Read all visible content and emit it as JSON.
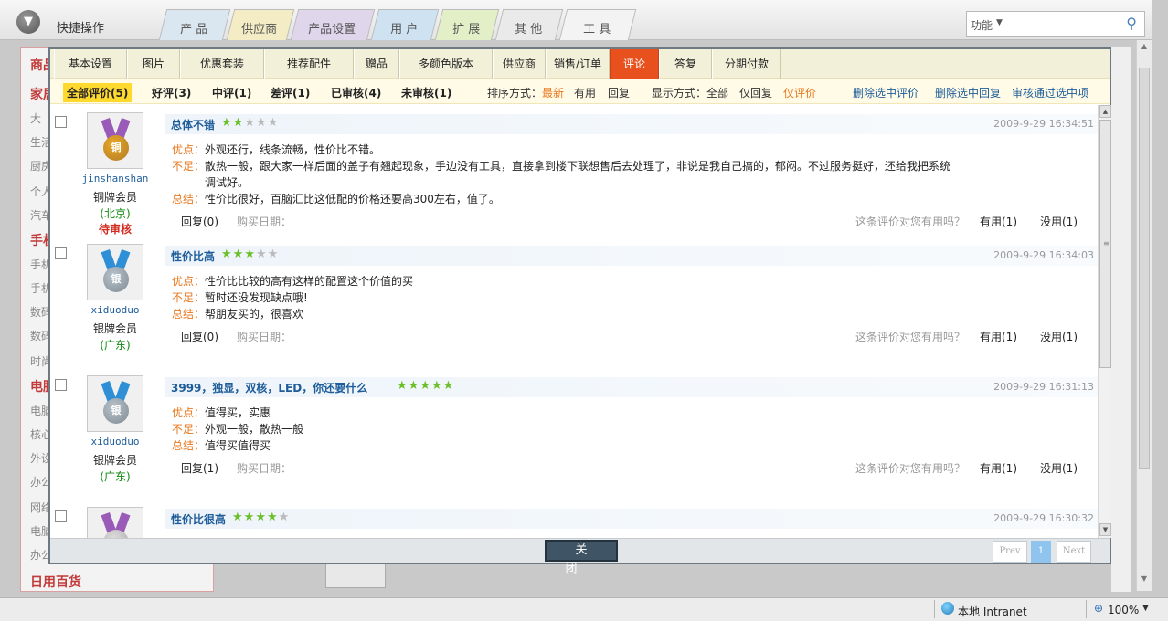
{
  "app": {
    "quick_ops": "快捷操作",
    "main_tabs": [
      "产 品",
      "供应商",
      "产品设置",
      "用 户",
      "扩 展",
      "其 他",
      "工 具"
    ],
    "func_label": "功能",
    "sidebar_bg": [
      {
        "text": "商品",
        "type": "head"
      },
      {
        "text": "家居",
        "type": "head"
      },
      {
        "text": "大",
        "type": "item"
      },
      {
        "text": "生活",
        "type": "item"
      },
      {
        "text": "厨房",
        "type": "item"
      },
      {
        "text": "个人",
        "type": "item"
      },
      {
        "text": "汽车",
        "type": "item"
      },
      {
        "text": "手机",
        "type": "head"
      },
      {
        "text": "手机",
        "type": "item"
      },
      {
        "text": "手机",
        "type": "item"
      },
      {
        "text": "数码",
        "type": "item"
      },
      {
        "text": "数码",
        "type": "item"
      },
      {
        "text": "时尚",
        "type": "item"
      },
      {
        "text": "电脑",
        "type": "head"
      },
      {
        "text": "电脑",
        "type": "item"
      },
      {
        "text": "核心",
        "type": "item"
      },
      {
        "text": "外设",
        "type": "item"
      },
      {
        "text": "办公",
        "type": "item"
      },
      {
        "text": "网络",
        "type": "item"
      },
      {
        "text": "电脑",
        "type": "item"
      },
      {
        "text": "办公",
        "type": "item"
      },
      {
        "text": "日用百货",
        "type": "head"
      }
    ],
    "statusbar": {
      "zone": "本地 Intranet",
      "zoom": "100%"
    }
  },
  "modal": {
    "tabs": [
      "基本设置",
      "图片",
      "优惠套装",
      "推荐配件",
      "赠品",
      "多颜色版本",
      "供应商",
      "销售/订单",
      "评论",
      "答复",
      "分期付款"
    ],
    "active_tab": "评论",
    "filters": {
      "all": "全部评价(5)",
      "good": "好评(3)",
      "mid": "中评(1)",
      "bad": "差评(1)",
      "reviewed": "已审核(4)",
      "unreviewed": "未审核(1)",
      "sort_label": "排序方式：",
      "sort_latest": "最新",
      "sort_useful": "有用",
      "sort_reply": "回复",
      "display_label": "显示方式：全部",
      "only_reply": "仅回复",
      "only_review": "仅评价",
      "del_reviews": "删除选中评价",
      "del_replies": "删除选中回复",
      "approve": "审核通过选中项"
    },
    "reviews": [
      {
        "user": "jinshanshan",
        "level": "铜牌会员",
        "location": "(北京)",
        "status": "待审核",
        "medal": "铜",
        "title": "总体不错",
        "stars": 2,
        "date": "2009-9-29 16:34:51",
        "pros_label": "优点：",
        "pros": "外观还行，线条流畅，性价比不错。",
        "cons_label": "不足：",
        "cons": "散热一般，跟大家一样后面的盖子有翘起现象，手边没有工具，直接拿到楼下联想售后去处理了，非说是我自己搞的，郁闷。不过服务挺好，还给我把系统",
        "cons2": "调试好。",
        "summary_label": "总结：",
        "summary": "性价比很好，百脑汇比这低配的价格还要高300左右，值了。",
        "reply": "回复(0)",
        "buy_date": "购买日期：",
        "question": "这条评价对您有用吗？",
        "useful": "有用(1)",
        "useless": "没用(1)"
      },
      {
        "user": "xiduoduo",
        "level": "银牌会员",
        "location": "(广东)",
        "status": "",
        "medal": "银",
        "title": "性价比高",
        "stars": 3,
        "date": "2009-9-29 16:34:03",
        "pros_label": "优点：",
        "pros": "性价比比较的高有这样的配置这个价值的买",
        "cons_label": "不足：",
        "cons": "暂时还没发现缺点哦!",
        "cons2": "",
        "summary_label": "总结：",
        "summary": "帮朋友买的，很喜欢",
        "reply": "回复(0)",
        "buy_date": "购买日期：",
        "question": "这条评价对您有用吗？",
        "useful": "有用(1)",
        "useless": "没用(1)"
      },
      {
        "user": "xiduoduo",
        "level": "银牌会员",
        "location": "(广东)",
        "status": "",
        "medal": "银",
        "title": "3999，独显，双核，LED，你还要什么",
        "stars": 5,
        "date": "2009-9-29 16:31:13",
        "pros_label": "优点：",
        "pros": "值得买，实惠",
        "cons_label": "不足：",
        "cons": "外观一般，散热一般",
        "cons2": "",
        "summary_label": "总结：",
        "summary": "值得买值得买",
        "reply": "回复(1)",
        "buy_date": "购买日期：",
        "question": "这条评价对您有用吗？",
        "useful": "有用(1)",
        "useless": "没用(1)"
      },
      {
        "user": "",
        "level": "",
        "location": "",
        "status": "",
        "medal": "",
        "title": "性价比很高",
        "stars": 4,
        "date": "2009-9-29 16:30:32",
        "pros_label": "",
        "pros": "",
        "cons_label": "",
        "cons": "",
        "cons2": "",
        "summary_label": "",
        "summary": "",
        "reply": "",
        "buy_date": "",
        "question": "",
        "useful": "",
        "useless": ""
      }
    ],
    "close_label": "关闭",
    "pager": {
      "prev": "Prev",
      "current": "1",
      "next": "Next"
    }
  },
  "colors": {
    "active_tab": "#e8501e",
    "star_on": "#6bbf2a",
    "pending": "#d22a1e",
    "link_blue": "#1e5d9a",
    "label_orange": "#e8781e"
  }
}
